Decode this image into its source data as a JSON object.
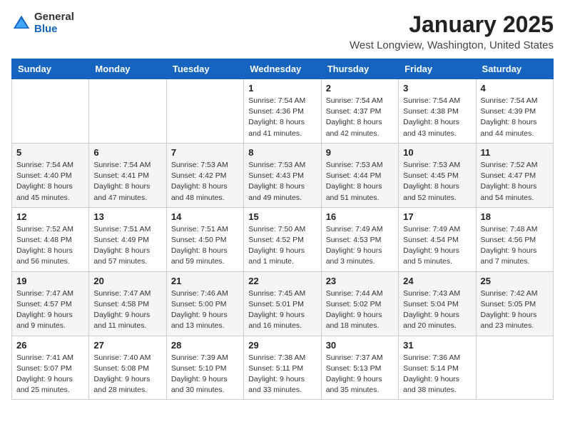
{
  "logo": {
    "general": "General",
    "blue": "Blue"
  },
  "title": "January 2025",
  "subtitle": "West Longview, Washington, United States",
  "days_of_week": [
    "Sunday",
    "Monday",
    "Tuesday",
    "Wednesday",
    "Thursday",
    "Friday",
    "Saturday"
  ],
  "weeks": [
    [
      {
        "day": "",
        "content": ""
      },
      {
        "day": "",
        "content": ""
      },
      {
        "day": "",
        "content": ""
      },
      {
        "day": "1",
        "content": "Sunrise: 7:54 AM\nSunset: 4:36 PM\nDaylight: 8 hours and 41 minutes."
      },
      {
        "day": "2",
        "content": "Sunrise: 7:54 AM\nSunset: 4:37 PM\nDaylight: 8 hours and 42 minutes."
      },
      {
        "day": "3",
        "content": "Sunrise: 7:54 AM\nSunset: 4:38 PM\nDaylight: 8 hours and 43 minutes."
      },
      {
        "day": "4",
        "content": "Sunrise: 7:54 AM\nSunset: 4:39 PM\nDaylight: 8 hours and 44 minutes."
      }
    ],
    [
      {
        "day": "5",
        "content": "Sunrise: 7:54 AM\nSunset: 4:40 PM\nDaylight: 8 hours and 45 minutes."
      },
      {
        "day": "6",
        "content": "Sunrise: 7:54 AM\nSunset: 4:41 PM\nDaylight: 8 hours and 47 minutes."
      },
      {
        "day": "7",
        "content": "Sunrise: 7:53 AM\nSunset: 4:42 PM\nDaylight: 8 hours and 48 minutes."
      },
      {
        "day": "8",
        "content": "Sunrise: 7:53 AM\nSunset: 4:43 PM\nDaylight: 8 hours and 49 minutes."
      },
      {
        "day": "9",
        "content": "Sunrise: 7:53 AM\nSunset: 4:44 PM\nDaylight: 8 hours and 51 minutes."
      },
      {
        "day": "10",
        "content": "Sunrise: 7:53 AM\nSunset: 4:45 PM\nDaylight: 8 hours and 52 minutes."
      },
      {
        "day": "11",
        "content": "Sunrise: 7:52 AM\nSunset: 4:47 PM\nDaylight: 8 hours and 54 minutes."
      }
    ],
    [
      {
        "day": "12",
        "content": "Sunrise: 7:52 AM\nSunset: 4:48 PM\nDaylight: 8 hours and 56 minutes."
      },
      {
        "day": "13",
        "content": "Sunrise: 7:51 AM\nSunset: 4:49 PM\nDaylight: 8 hours and 57 minutes."
      },
      {
        "day": "14",
        "content": "Sunrise: 7:51 AM\nSunset: 4:50 PM\nDaylight: 8 hours and 59 minutes."
      },
      {
        "day": "15",
        "content": "Sunrise: 7:50 AM\nSunset: 4:52 PM\nDaylight: 9 hours and 1 minute."
      },
      {
        "day": "16",
        "content": "Sunrise: 7:49 AM\nSunset: 4:53 PM\nDaylight: 9 hours and 3 minutes."
      },
      {
        "day": "17",
        "content": "Sunrise: 7:49 AM\nSunset: 4:54 PM\nDaylight: 9 hours and 5 minutes."
      },
      {
        "day": "18",
        "content": "Sunrise: 7:48 AM\nSunset: 4:56 PM\nDaylight: 9 hours and 7 minutes."
      }
    ],
    [
      {
        "day": "19",
        "content": "Sunrise: 7:47 AM\nSunset: 4:57 PM\nDaylight: 9 hours and 9 minutes."
      },
      {
        "day": "20",
        "content": "Sunrise: 7:47 AM\nSunset: 4:58 PM\nDaylight: 9 hours and 11 minutes."
      },
      {
        "day": "21",
        "content": "Sunrise: 7:46 AM\nSunset: 5:00 PM\nDaylight: 9 hours and 13 minutes."
      },
      {
        "day": "22",
        "content": "Sunrise: 7:45 AM\nSunset: 5:01 PM\nDaylight: 9 hours and 16 minutes."
      },
      {
        "day": "23",
        "content": "Sunrise: 7:44 AM\nSunset: 5:02 PM\nDaylight: 9 hours and 18 minutes."
      },
      {
        "day": "24",
        "content": "Sunrise: 7:43 AM\nSunset: 5:04 PM\nDaylight: 9 hours and 20 minutes."
      },
      {
        "day": "25",
        "content": "Sunrise: 7:42 AM\nSunset: 5:05 PM\nDaylight: 9 hours and 23 minutes."
      }
    ],
    [
      {
        "day": "26",
        "content": "Sunrise: 7:41 AM\nSunset: 5:07 PM\nDaylight: 9 hours and 25 minutes."
      },
      {
        "day": "27",
        "content": "Sunrise: 7:40 AM\nSunset: 5:08 PM\nDaylight: 9 hours and 28 minutes."
      },
      {
        "day": "28",
        "content": "Sunrise: 7:39 AM\nSunset: 5:10 PM\nDaylight: 9 hours and 30 minutes."
      },
      {
        "day": "29",
        "content": "Sunrise: 7:38 AM\nSunset: 5:11 PM\nDaylight: 9 hours and 33 minutes."
      },
      {
        "day": "30",
        "content": "Sunrise: 7:37 AM\nSunset: 5:13 PM\nDaylight: 9 hours and 35 minutes."
      },
      {
        "day": "31",
        "content": "Sunrise: 7:36 AM\nSunset: 5:14 PM\nDaylight: 9 hours and 38 minutes."
      },
      {
        "day": "",
        "content": ""
      }
    ]
  ]
}
